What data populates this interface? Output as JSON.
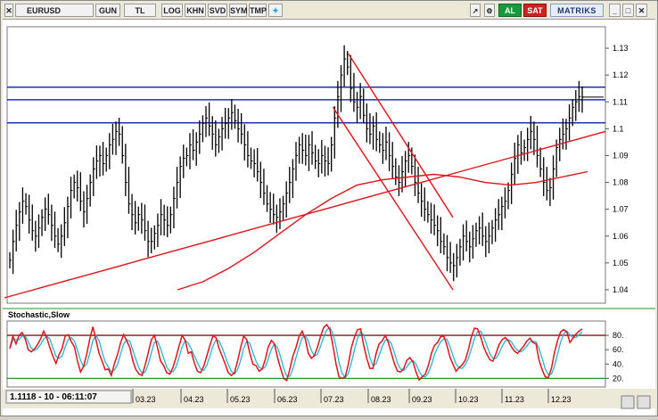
{
  "toolbar": {
    "symbol": "EURUSD",
    "buttons": [
      "GUN",
      "TL",
      "LOG",
      "KHN",
      "SVD",
      "SYM",
      "TMP"
    ],
    "al_label": "AL",
    "sat_label": "SAT",
    "brand_label": "MATRIKS"
  },
  "status": {
    "readout": "1.1118 - 10 - 06:11:07"
  },
  "colors": {
    "price": "#000000",
    "trendline": "#e0141a",
    "resistance": "#1f2fc4",
    "stoch_k": "#e0141a",
    "stoch_d": "#20b8d8",
    "stoch_upper": "#8a1010",
    "stoch_lower": "#1e9a24"
  },
  "chart_data": [
    {
      "type": "line",
      "title": "",
      "symbol": "EURUSD",
      "x_ticks": [
        "03.23",
        "04.23",
        "05.23",
        "06.23",
        "07.23",
        "08.23",
        "09.23",
        "10.23",
        "11.23",
        "12.23"
      ],
      "y_ticks": [
        1.13,
        1.12,
        1.11,
        1.1,
        1.09,
        1.08,
        1.07,
        1.06,
        1.05,
        1.04
      ],
      "ylim": [
        1.035,
        1.138
      ],
      "last_value": 1.1118,
      "series": [
        {
          "values": [
            1.051,
            1.058,
            1.064,
            1.069,
            1.073,
            1.071,
            1.066,
            1.062,
            1.06,
            1.063,
            1.067,
            1.07,
            1.068,
            1.064,
            1.06,
            1.057,
            1.06,
            1.065,
            1.071,
            1.077,
            1.08,
            1.078,
            1.073,
            1.069,
            1.074,
            1.08,
            1.085,
            1.088,
            1.09,
            1.087,
            1.09,
            1.094,
            1.096,
            1.099,
            1.098,
            1.09,
            1.08,
            1.072,
            1.068,
            1.065,
            1.068,
            1.066,
            1.062,
            1.058,
            1.058,
            1.061,
            1.064,
            1.068,
            1.066,
            1.064,
            1.068,
            1.074,
            1.08,
            1.086,
            1.089,
            1.09,
            1.094,
            1.092,
            1.095,
            1.098,
            1.102,
            1.104,
            1.101,
            1.098,
            1.094,
            1.097,
            1.1,
            1.102,
            1.104,
            1.106,
            1.103,
            1.1,
            1.098,
            1.094,
            1.09,
            1.088,
            1.087,
            1.084,
            1.08,
            1.076,
            1.072,
            1.07,
            1.068,
            1.067,
            1.069,
            1.072,
            1.076,
            1.08,
            1.085,
            1.09,
            1.094,
            1.092,
            1.09,
            1.094,
            1.091,
            1.088,
            1.087,
            1.09,
            1.088,
            1.087,
            1.094,
            1.104,
            1.112,
            1.12,
            1.126,
            1.123,
            1.115,
            1.11,
            1.108,
            1.112,
            1.105,
            1.1,
            1.098,
            1.101,
            1.096,
            1.094,
            1.092,
            1.095,
            1.09,
            1.086,
            1.082,
            1.08,
            1.084,
            1.088,
            1.09,
            1.086,
            1.08,
            1.076,
            1.073,
            1.07,
            1.068,
            1.066,
            1.064,
            1.062,
            1.058,
            1.056,
            1.052,
            1.05,
            1.049,
            1.052,
            1.056,
            1.06,
            1.058,
            1.056,
            1.059,
            1.062,
            1.063,
            1.06,
            1.058,
            1.06,
            1.063,
            1.066,
            1.068,
            1.071,
            1.073,
            1.077,
            1.083,
            1.089,
            1.094,
            1.091,
            1.093,
            1.096,
            1.099,
            1.096,
            1.09,
            1.085,
            1.08,
            1.077,
            1.078,
            1.085,
            1.093,
            1.096,
            1.098,
            1.1,
            1.104,
            1.108,
            1.11,
            1.112,
            1.1118
          ]
        },
        {
          "values": [
            1.037,
            1.039,
            1.041,
            1.043,
            1.045,
            1.047,
            1.049,
            1.051,
            1.053,
            1.055,
            1.057,
            1.059,
            1.061,
            1.063,
            1.065,
            1.067,
            1.069,
            1.071,
            1.073,
            1.075,
            1.077,
            1.079,
            1.081,
            1.083,
            1.085,
            1.087,
            1.089,
            1.091,
            1.093,
            1.095,
            1.097,
            1.099
          ]
        },
        {
          "values": [
            1.04,
            1.043,
            1.048,
            1.054,
            1.061,
            1.068,
            1.074,
            1.079,
            1.081,
            1.082,
            1.083,
            1.082,
            1.08,
            1.079,
            1.08,
            1.082,
            1.084
          ]
        }
      ],
      "trendlines": [
        {
          "x0": 0,
          "y0": 1.038,
          "x1": 186,
          "y1": 1.098
        },
        {
          "x0": 0,
          "y0": 1.038,
          "x1": 186,
          "y1": 1.098
        },
        {
          "x0": 105,
          "y0": 1.108,
          "x1": 144,
          "y1": 1.04
        },
        {
          "x0": 110,
          "y0": 1.128,
          "x1": 144,
          "y1": 1.067
        }
      ],
      "hlines": [
        1.1155,
        1.1108,
        1.1022
      ]
    },
    {
      "type": "line",
      "title": "Stochastic,Slow",
      "y_ticks": [
        80,
        60,
        40,
        20
      ],
      "ylim": [
        8,
        100
      ],
      "hlines": [
        80,
        20
      ],
      "series": [
        {
          "values": [
            62,
            79,
            68,
            80,
            84,
            75,
            60,
            57,
            61,
            67,
            75,
            86,
            77,
            63,
            51,
            41,
            53,
            62,
            79,
            81,
            71,
            64,
            44,
            29,
            37,
            54,
            75,
            92,
            74,
            55,
            44,
            32,
            33,
            24,
            41,
            53,
            70,
            81,
            72,
            63,
            44,
            32,
            26,
            24,
            39,
            56,
            74,
            80,
            63,
            44,
            38,
            28,
            26,
            35,
            49,
            65,
            80,
            73,
            55,
            57,
            41,
            30,
            28,
            37,
            51,
            66,
            79,
            77,
            62,
            51,
            40,
            28,
            24,
            28,
            44,
            63,
            79,
            74,
            55,
            40,
            38,
            30,
            33,
            46,
            64,
            73,
            68,
            49,
            34,
            20,
            17,
            33,
            51,
            63,
            79,
            86,
            75,
            55,
            48,
            52,
            64,
            79,
            91,
            95,
            88,
            66,
            40,
            22,
            20,
            22,
            40,
            63,
            78,
            88,
            89,
            66,
            48,
            34,
            34,
            54,
            68,
            72,
            80,
            70,
            55,
            40,
            30,
            29,
            34,
            45,
            49,
            43,
            29,
            18,
            22,
            26,
            38,
            55,
            66,
            70,
            78,
            79,
            67,
            50,
            40,
            30,
            35,
            39,
            45,
            60,
            78,
            90,
            89,
            78,
            64,
            54,
            46,
            44,
            55,
            67,
            74,
            77,
            72,
            64,
            58,
            55,
            60,
            65,
            72,
            76,
            70,
            68,
            45,
            32,
            22,
            21,
            34,
            56,
            73,
            85,
            88,
            85,
            70,
            76,
            82,
            86,
            89
          ]
        },
        {
          "values": [
            61,
            74,
            74,
            74,
            79,
            79,
            71,
            62,
            59,
            62,
            67,
            75,
            79,
            75,
            63,
            51,
            48,
            51,
            64,
            74,
            77,
            72,
            59,
            45,
            36,
            40,
            55,
            73,
            80,
            73,
            57,
            43,
            36,
            29,
            32,
            39,
            54,
            68,
            74,
            72,
            59,
            46,
            34,
            27,
            29,
            40,
            56,
            70,
            72,
            62,
            48,
            36,
            30,
            29,
            36,
            49,
            64,
            73,
            69,
            61,
            51,
            42,
            33,
            31,
            38,
            51,
            65,
            74,
            72,
            63,
            51,
            39,
            30,
            26,
            32,
            45,
            62,
            72,
            69,
            56,
            44,
            36,
            33,
            36,
            47,
            61,
            68,
            63,
            50,
            34,
            23,
            23,
            33,
            49,
            64,
            76,
            80,
            72,
            59,
            51,
            54,
            65,
            78,
            88,
            91,
            83,
            64,
            42,
            27,
            21,
            27,
            42,
            60,
            76,
            85,
            81,
            67,
            49,
            38,
            40,
            52,
            64,
            73,
            74,
            68,
            55,
            41,
            33,
            31,
            36,
            42,
            45,
            40,
            30,
            23,
            22,
            28,
            39,
            53,
            63,
            71,
            75,
            75,
            65,
            52,
            40,
            35,
            34,
            39,
            48,
            61,
            76,
            85,
            86,
            77,
            66,
            54,
            48,
            48,
            55,
            65,
            72,
            74,
            71,
            64,
            59,
            57,
            60,
            65,
            71,
            72,
            71,
            61,
            48,
            33,
            25,
            26,
            37,
            54,
            71,
            82,
            86,
            81,
            77,
            77,
            81,
            85
          ]
        }
      ]
    }
  ]
}
